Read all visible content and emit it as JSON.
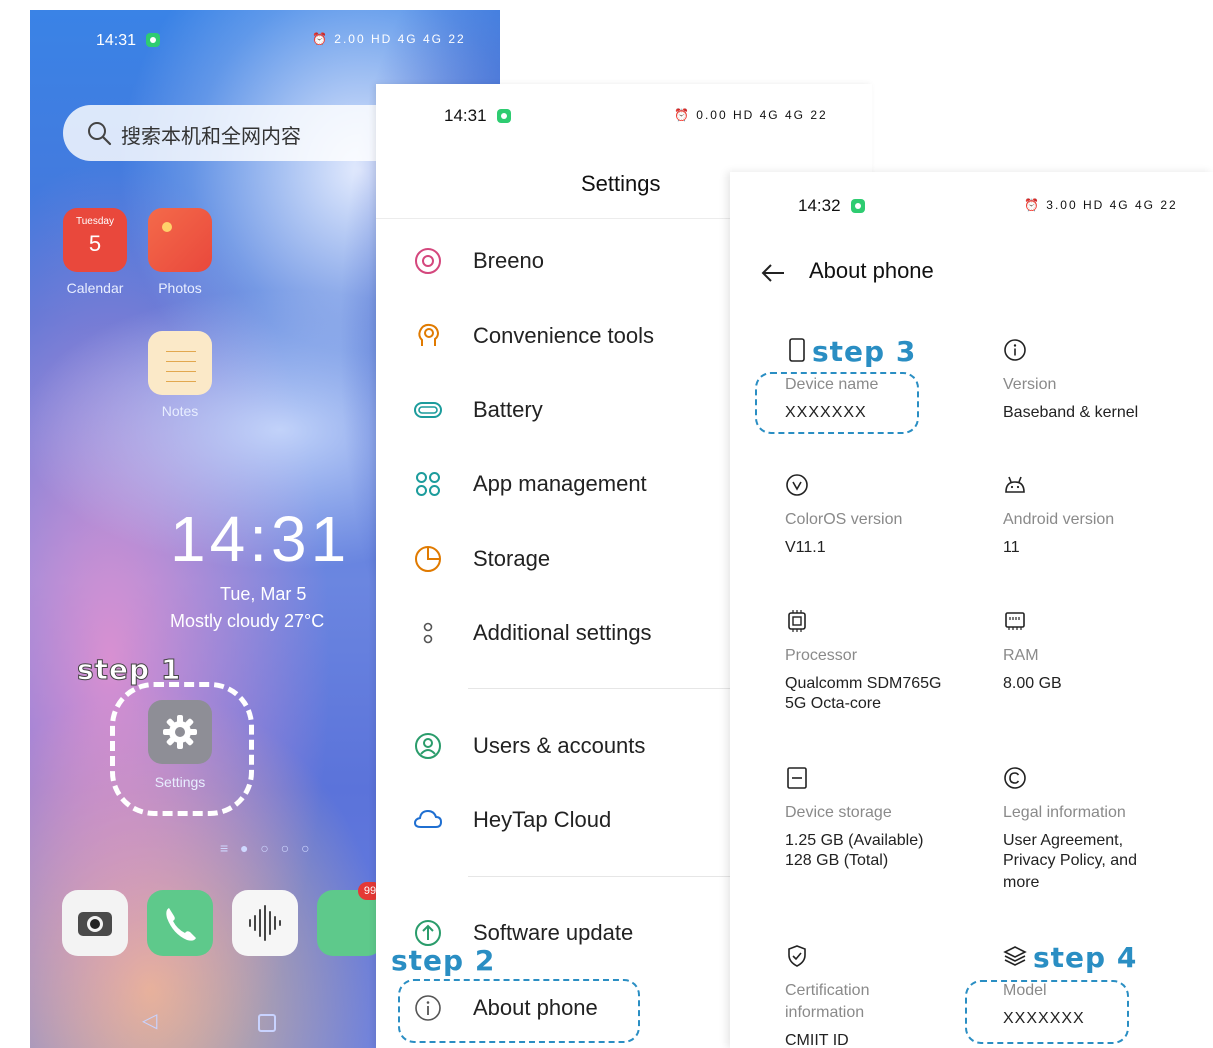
{
  "home": {
    "time": "14:31",
    "status_icons": "⏰ 2.00 HD 4G 4G 22",
    "search_placeholder": "搜索本机和全网内容",
    "calendar": {
      "day": "Tuesday",
      "date": "5",
      "label": "Calendar"
    },
    "photos_label": "Photos",
    "notes_label": "Notes",
    "clock": "14:31",
    "date": "Tue, Mar 5",
    "weather": "Mostly cloudy 27°C",
    "step_label": "step 1",
    "settings_label": "Settings",
    "badge": "99"
  },
  "settings": {
    "time": "14:31",
    "status_icons": "⏰ 0.00 HD 4G 4G 22",
    "title": "Settings",
    "items": [
      {
        "label": "Breeno",
        "icon": "breeno-icon"
      },
      {
        "label": "Convenience tools",
        "icon": "convenience-tools-icon"
      },
      {
        "label": "Battery",
        "icon": "battery-icon"
      },
      {
        "label": "App management",
        "icon": "app-management-icon"
      },
      {
        "label": "Storage",
        "icon": "storage-icon"
      },
      {
        "label": "Additional settings",
        "icon": "additional-settings-icon"
      },
      {
        "label": "Users & accounts",
        "icon": "users-accounts-icon"
      },
      {
        "label": "HeyTap Cloud",
        "icon": "cloud-icon"
      },
      {
        "label": "Software update",
        "icon": "software-update-icon"
      },
      {
        "label": "About phone",
        "icon": "info-icon"
      }
    ],
    "step_label": "step 2"
  },
  "about": {
    "time": "14:32",
    "status_icons": "⏰ 3.00 HD 4G 4G 22",
    "title": "About phone",
    "step3_label": "step 3",
    "step4_label": "step 4",
    "device_name": {
      "label": "Device name",
      "value": "XXXXXXX"
    },
    "version": {
      "label": "Version",
      "value": "Baseband & kernel"
    },
    "coloros": {
      "label": "ColorOS version",
      "value": "V11.1"
    },
    "android": {
      "label": "Android version",
      "value": "11"
    },
    "processor": {
      "label": "Processor",
      "value": "Qualcomm SDM765G",
      "value2": "5G Octa-core"
    },
    "ram": {
      "label": "RAM",
      "value": "8.00 GB"
    },
    "storage": {
      "label": "Device storage",
      "value": "1.25 GB (Available)",
      "value2": "128 GB (Total)"
    },
    "legal": {
      "label": "Legal information",
      "value": "User Agreement,",
      "value2": "Privacy Policy, and",
      "value3": "more"
    },
    "certification": {
      "label": "Certification",
      "label2": "information",
      "value": "CMIIT ID"
    },
    "model": {
      "label": "Model",
      "value": "XXXXXXX"
    }
  },
  "colors": {
    "accent": "#2a8ec3",
    "primary_icon": "#e07a00"
  }
}
